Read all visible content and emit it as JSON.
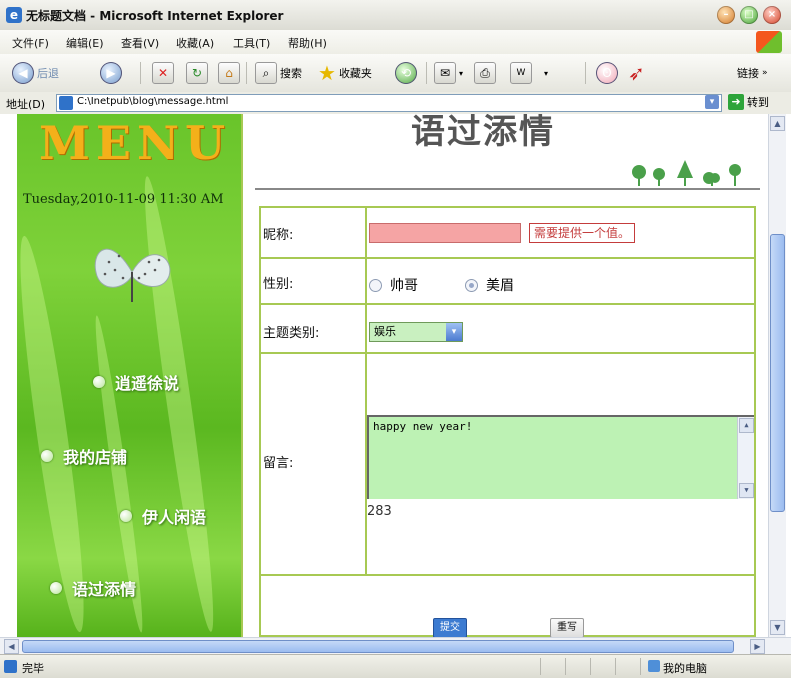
{
  "window": {
    "title": "无标题文档 - Microsoft Internet Explorer",
    "controls": [
      "minimize",
      "maximize",
      "close"
    ]
  },
  "menubar": {
    "items": [
      "文件(F)",
      "编辑(E)",
      "查看(V)",
      "收藏(A)",
      "工具(T)",
      "帮助(H)"
    ]
  },
  "toolbar": {
    "back_label": "后退",
    "search_label": "搜索",
    "favorites_label": "收藏夹",
    "links_label": "链接"
  },
  "addressbar": {
    "label": "地址(D)",
    "url": "C:\\Inetpub\\blog\\message.html",
    "go_label": "转到"
  },
  "left_menu": {
    "logo_text": "MENU",
    "datetime": "Tuesday,2010-11-09 11:30 AM",
    "links": [
      "逍遥徐说",
      "我的店铺",
      "伊人闲语",
      "语过添情"
    ]
  },
  "content": {
    "heading": "语过添情",
    "form": {
      "nickname_label": "昵称:",
      "nickname_value": "",
      "nickname_error": "需要提供一个值。",
      "gender_label": "性别:",
      "gender_options": [
        {
          "label": "帅哥",
          "selected": false
        },
        {
          "label": "美眉",
          "selected": true
        }
      ],
      "category_label": "主题类别:",
      "category_value": "娱乐",
      "message_label": "留言:",
      "message_value": "happy new year!",
      "char_count": "283",
      "submit_label": "提交",
      "reset_label": "重写"
    }
  },
  "statusbar": {
    "status_text": "完毕",
    "zone_text": "我的电脑"
  },
  "colors": {
    "menu_green": "#69c42a",
    "table_border": "#a7c953",
    "error_red": "#c43c3c",
    "input_error_bg": "#f5a4a4",
    "textarea_bg": "#bdf2b4"
  }
}
